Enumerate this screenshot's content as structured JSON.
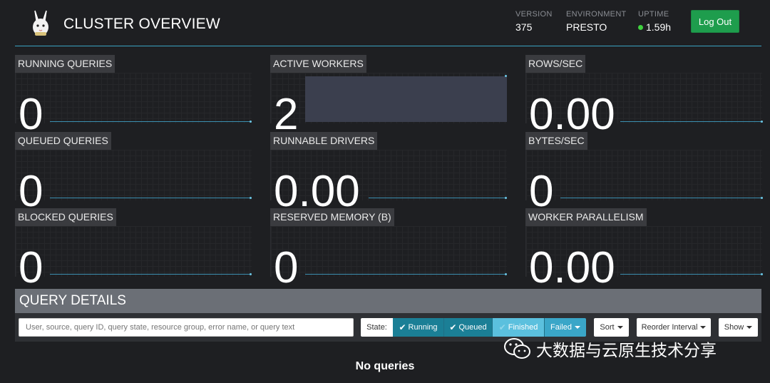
{
  "header": {
    "title": "CLUSTER OVERVIEW",
    "meta": [
      {
        "key": "VERSION",
        "value": "375"
      },
      {
        "key": "ENVIRONMENT",
        "value": "PRESTO"
      },
      {
        "key": "UPTIME",
        "value": "1.59h"
      }
    ],
    "logout_label": "Log Out",
    "uptime_status_color": "#3fd23f"
  },
  "stats": [
    {
      "label": "RUNNING QUERIES",
      "value": "0"
    },
    {
      "label": "ACTIVE WORKERS",
      "value": "2"
    },
    {
      "label": "ROWS/SEC",
      "value": "0.00"
    },
    {
      "label": "QUEUED QUERIES",
      "value": "0"
    },
    {
      "label": "RUNNABLE DRIVERS",
      "value": "0.00"
    },
    {
      "label": "BYTES/SEC",
      "value": "0"
    },
    {
      "label": "BLOCKED QUERIES",
      "value": "0"
    },
    {
      "label": "RESERVED MEMORY (B)",
      "value": "0"
    },
    {
      "label": "WORKER PARALLELISM",
      "value": "0.00"
    }
  ],
  "query_details": {
    "title": "QUERY DETAILS",
    "search_placeholder": "User, source, query ID, query state, resource group, error name, or query text",
    "state_label": "State:",
    "state_filters": [
      {
        "label": "Running",
        "checked": true
      },
      {
        "label": "Queued",
        "checked": true
      },
      {
        "label": "Finished",
        "checked": true
      },
      {
        "label": "Failed",
        "dropdown": true
      }
    ],
    "sort_label": "Sort",
    "reorder_label": "Reorder Interval",
    "show_label": "Show",
    "empty_text": "No queries"
  },
  "watermark": {
    "text": "大数据与云原生技术分享"
  },
  "colors": {
    "accent_line": "#3aa3c3",
    "running_btn": "#1b7f96",
    "queued_btn": "#1b7f96",
    "finished_btn": "#5bc0de",
    "failed_btn": "#3aa6c8",
    "logout_btn": "#1e9d4d"
  }
}
